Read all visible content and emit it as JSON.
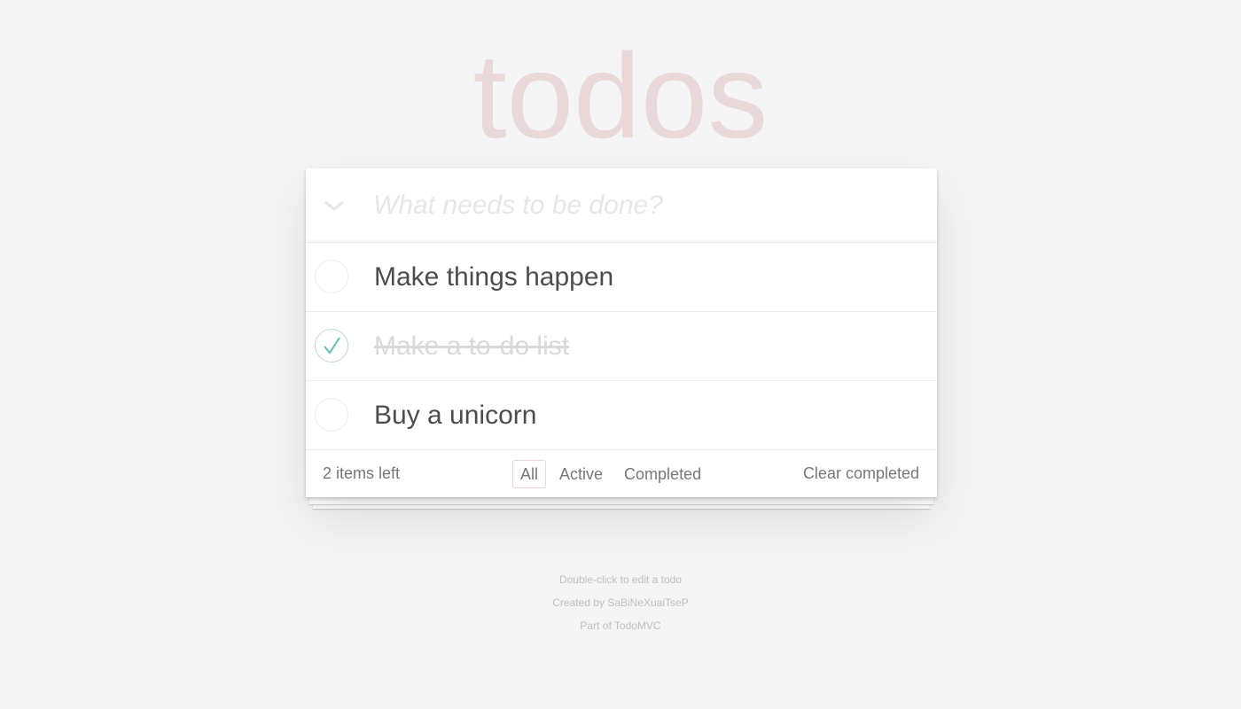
{
  "header": {
    "title": "todos",
    "new_todo_placeholder": "What needs to be done?"
  },
  "todos": [
    {
      "title": "Make things happen",
      "completed": false
    },
    {
      "title": "Make a to-do list",
      "completed": true
    },
    {
      "title": "Buy a unicorn",
      "completed": false
    }
  ],
  "footer": {
    "count_label": "2 items left",
    "filters": [
      {
        "label": "All",
        "selected": true
      },
      {
        "label": "Active",
        "selected": false
      },
      {
        "label": "Completed",
        "selected": false
      }
    ],
    "clear_label": "Clear completed"
  },
  "info": {
    "hint": "Double-click to edit a todo",
    "created_by": "Created by SaBiNeXuaiTseP",
    "part_of": "Part of TodoMVC"
  },
  "colors": {
    "title": "#f0dada",
    "check": "#5dc2af",
    "background": "#f5f5f5"
  },
  "icons": {
    "toggle_all": "chevron-down-icon",
    "check": "checkmark-icon"
  }
}
